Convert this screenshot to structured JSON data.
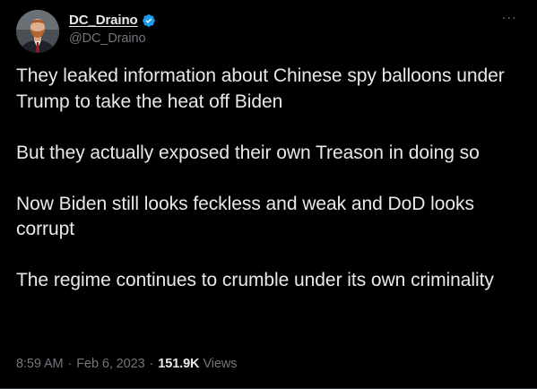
{
  "author": {
    "display_name": "DC_Draino",
    "handle": "@DC_Draino",
    "verified": true,
    "avatar_icon": "profile-photo-icon",
    "verified_color": "#1d9bf0"
  },
  "menu": {
    "more_icon": "more-options-icon",
    "more_glyph": "···"
  },
  "tweet": {
    "paragraphs": [
      "They leaked information about Chinese spy balloons under Trump to take the heat off Biden",
      "But they actually exposed their own Treason in doing so",
      "Now Biden still looks feckless and weak and DoD looks corrupt",
      "The regime continues to crumble under its own criminality"
    ]
  },
  "meta": {
    "time": "8:59 AM",
    "separator": "·",
    "date": "Feb 6, 2023",
    "views_count": "151.9K",
    "views_label": "Views"
  },
  "colors": {
    "background": "#000000",
    "text": "#e7e9ea",
    "secondary": "#71767b"
  }
}
